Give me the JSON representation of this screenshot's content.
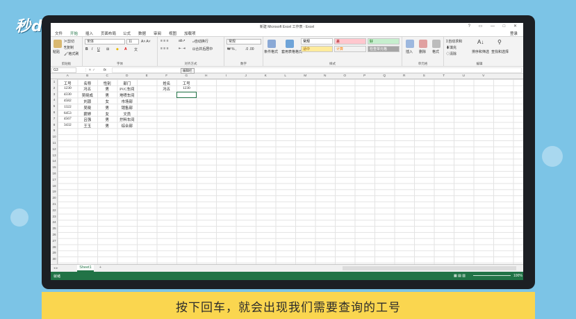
{
  "watermark": {
    "logo_text": "秒dong视频"
  },
  "window": {
    "title": "新建 Microsoft Excel 工作表 - Excel",
    "controls": [
      "?",
      "▭",
      "—",
      "□",
      "✕"
    ]
  },
  "ribbon_tabs": {
    "items": [
      "文件",
      "开始",
      "插入",
      "页面布局",
      "公式",
      "数据",
      "审阅",
      "视图",
      "加载项"
    ],
    "login": "登录"
  },
  "ribbon": {
    "clipboard": {
      "paste": "粘贴",
      "cut": "剪切",
      "copy": "复制",
      "format_painter": "格式刷",
      "label": "剪贴板"
    },
    "font": {
      "name": "宋体",
      "size": "11",
      "label": "字体"
    },
    "alignment": {
      "wrap": "自动换行",
      "merge": "合并后居中",
      "label": "对齐方式"
    },
    "number": {
      "format": "常规",
      "label": "数字"
    },
    "styles": {
      "conditional": "条件格式",
      "table": "套用表格格式",
      "items": [
        {
          "label": "常规",
          "bg": "#ffffff",
          "fg": "#000000"
        },
        {
          "label": "差",
          "bg": "#ffc7ce",
          "fg": "#9c0006"
        },
        {
          "label": "好",
          "bg": "#c6efce",
          "fg": "#006100"
        },
        {
          "label": "适中",
          "bg": "#ffeb9c",
          "fg": "#9c6500"
        },
        {
          "label": "计算",
          "bg": "#f2f2f2",
          "fg": "#fa7d00"
        },
        {
          "label": "检查单元格",
          "bg": "#a5a5a5",
          "fg": "#ffffff"
        }
      ],
      "label": "样式"
    },
    "cells": {
      "insert": "插入",
      "delete": "删除",
      "format": "格式",
      "label": "单元格"
    },
    "editing": {
      "autosum": "自动求和",
      "fill": "填充",
      "clear": "清除",
      "sort": "排序和筛选",
      "find": "查找和选择",
      "label": "编辑"
    }
  },
  "formula_bar": {
    "name_box": "G3",
    "fx": "fx",
    "value": ""
  },
  "columns": [
    "A",
    "B",
    "C",
    "D",
    "E",
    "F",
    "G",
    "H",
    "I",
    "J",
    "K",
    "L",
    "M",
    "N",
    "O",
    "P",
    "Q",
    "R",
    "S",
    "T",
    "U",
    "V"
  ],
  "rows": [
    "1",
    "2",
    "3",
    "4",
    "5",
    "6",
    "7",
    "8",
    "9",
    "10",
    "11",
    "12",
    "13",
    "14",
    "15",
    "16",
    "17",
    "18",
    "19",
    "20",
    "21",
    "22",
    "23",
    "24",
    "25",
    "26",
    "27",
    "28",
    "29",
    "30"
  ],
  "table": {
    "headers": [
      "工号",
      "名称",
      "性别",
      "部门"
    ],
    "rows": [
      [
        "1230",
        "冯五",
        "男",
        "PVC车间"
      ],
      [
        "4330",
        "吴晓成",
        "男",
        "地喷车间"
      ],
      [
        "4582",
        "刘源",
        "女",
        "市场部"
      ],
      [
        "1322",
        "吴晓",
        "男",
        "销售部"
      ],
      [
        "6453",
        "薪婷",
        "女",
        "文员"
      ],
      [
        "4567",
        "吕强",
        "男",
        "拧料车间"
      ],
      [
        "3432",
        "王玉",
        "男",
        "综合部"
      ]
    ]
  },
  "lookup": {
    "name_header": "姓名",
    "id_header": "工号",
    "name_value": "冯五",
    "id_value": "1230"
  },
  "tooltip": "编辑栏",
  "sheets": {
    "active": "Sheet1",
    "add": "+"
  },
  "status": {
    "mode": "就绪",
    "zoom": "100%"
  },
  "caption": "按下回车，就会出现我们需要查询的工号",
  "colors": {
    "excel_green": "#217346",
    "background": "#7cc4e6",
    "caption_bg": "#fad64f"
  }
}
